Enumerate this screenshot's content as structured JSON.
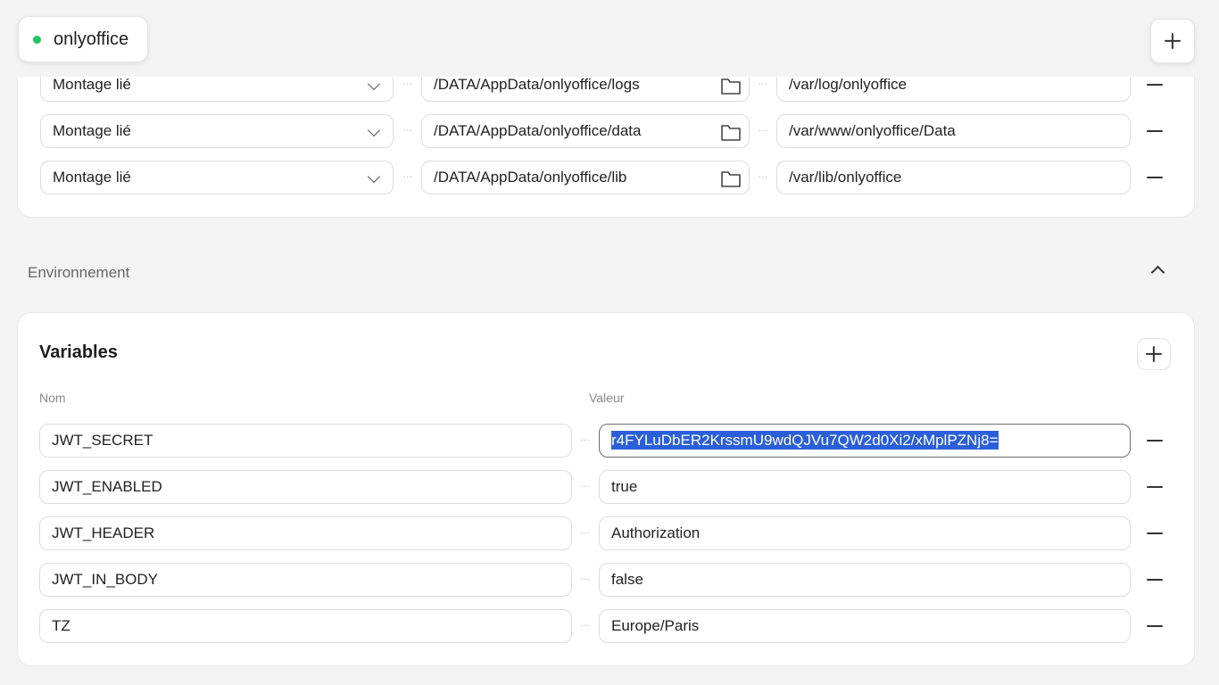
{
  "tag": {
    "label": "onlyoffice",
    "status_color": "#22c55e"
  },
  "volumes": [
    {
      "type": "Montage lié",
      "host_path": "/DATA/AppData/onlyoffice/logs",
      "container_path": "/var/log/onlyoffice"
    },
    {
      "type": "Montage lié",
      "host_path": "/DATA/AppData/onlyoffice/data",
      "container_path": "/var/www/onlyoffice/Data"
    },
    {
      "type": "Montage lié",
      "host_path": "/DATA/AppData/onlyoffice/lib",
      "container_path": "/var/lib/onlyoffice"
    }
  ],
  "environment": {
    "section_label": "Environnement",
    "title": "Variables",
    "col_name": "Nom",
    "col_value": "Valeur",
    "variables": [
      {
        "name": "JWT_SECRET",
        "value": "r4FYLuDbER2KrssmU9wdQJVu7QW2d0Xi2/xMplPZNj8="
      },
      {
        "name": "JWT_ENABLED",
        "value": "true"
      },
      {
        "name": "JWT_HEADER",
        "value": "Authorization"
      },
      {
        "name": "JWT_IN_BODY",
        "value": "false"
      },
      {
        "name": "TZ",
        "value": "Europe/Paris"
      }
    ]
  },
  "separator": "...",
  "colors": {
    "selection": "#2b5fd9",
    "accent_dot": "#22c55e"
  }
}
